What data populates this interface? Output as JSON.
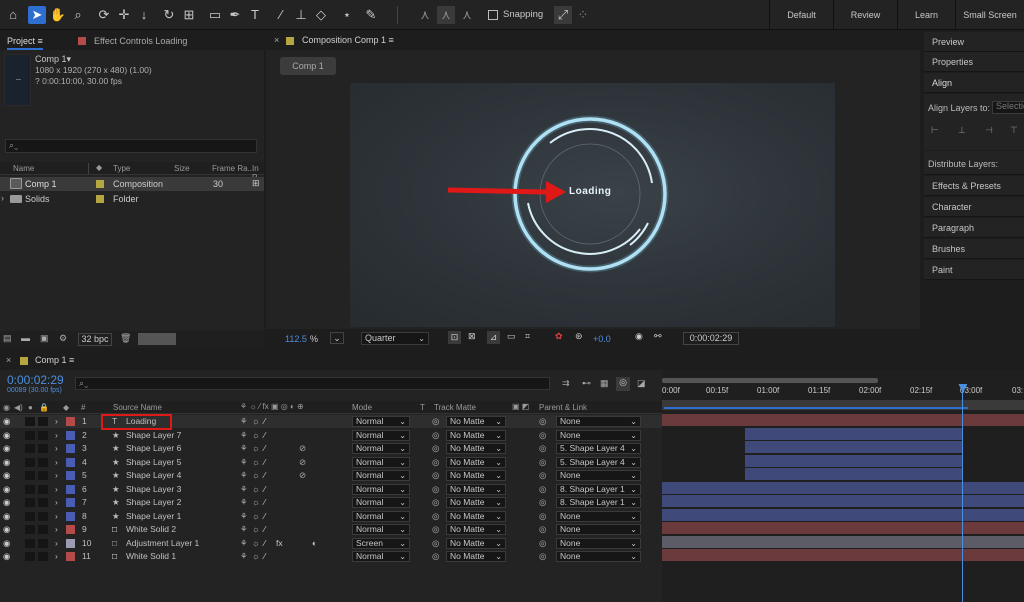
{
  "toolbar": {
    "icons": [
      "home-icon",
      "selection-tool-icon",
      "hand-tool-icon",
      "zoom-tool-icon",
      "orbit-camera-icon",
      "pan-camera-icon",
      "dolly-camera-icon",
      "rotation-tool-icon",
      "pan-behind-icon",
      "rectangle-tool-icon",
      "pen-tool-icon",
      "type-tool-icon",
      "brush-tool-icon",
      "clone-stamp-icon",
      "eraser-tool-icon",
      "roto-brush-icon",
      "puppet-pin-icon"
    ],
    "snapping_label": "Snapping",
    "workspaces": [
      "Default",
      "Review",
      "Learn",
      "Small Screen"
    ]
  },
  "project": {
    "tab_label": "Project",
    "effect_tab_label": "Effect Controls Loading",
    "comp_name": "Comp 1▾",
    "comp_dims": "1080 x 1920  (270 x 480) (1.00)",
    "comp_duration": "? 0:00:10:00, 30.00 fps",
    "search_placeholder": "",
    "columns": [
      "Name",
      "Type",
      "Size",
      "Frame Ra...",
      "In P"
    ],
    "items": [
      {
        "name": "Comp 1",
        "type": "Composition",
        "size": "",
        "fps": "30",
        "color": "#b5a642"
      },
      {
        "name": "Solids",
        "type": "Folder",
        "size": "",
        "fps": "",
        "color": "#b5a642"
      }
    ],
    "bpc_label": "32 bpc"
  },
  "composition": {
    "tab_label": "Composition Comp 1",
    "comp_button": "Comp 1",
    "loading_text": "Loading",
    "zoom": "112.5",
    "zoom_unit": "%",
    "resolution": "Quarter",
    "exposure": "+0.0",
    "timecode": "0:00:02:29"
  },
  "right_panel": {
    "items": [
      "Preview",
      "Properties",
      "Align"
    ],
    "align_layers_to": "Align Layers to:",
    "align_select": "Selection",
    "distribute": "Distribute Layers:",
    "more": [
      "Effects & Presets",
      "Character",
      "Paragraph",
      "Brushes",
      "Paint"
    ]
  },
  "timeline": {
    "tab_label": "Comp 1",
    "timecode": "0:00:02:29",
    "frame_info": "00089 (30.00 fps)",
    "col_source": "Source Name",
    "col_mode": "Mode",
    "col_t": "T",
    "col_track": "Track Matte",
    "col_parent": "Parent & Link",
    "ruler": [
      "0:00f",
      "00:15f",
      "01:00f",
      "01:15f",
      "02:00f",
      "02:15f",
      "03:00f",
      "03:"
    ],
    "playhead_fraction": 0.83,
    "layers": [
      {
        "n": "1",
        "name": "Loading",
        "kind": "text",
        "color": "#b44a4a",
        "mode": "Normal",
        "matte": "No Matte",
        "parent": "None",
        "bar_color": "#6a3a3c",
        "bar_start": 0.0,
        "bar_end": 1.0
      },
      {
        "n": "2",
        "name": "Shape Layer 7",
        "kind": "shape",
        "color": "#4a5db4",
        "mode": "Normal",
        "matte": "No Matte",
        "parent": "None",
        "bar_color": "#3f4a7a",
        "bar_start": 0.23,
        "bar_end": 0.83
      },
      {
        "n": "3",
        "name": "Shape Layer 6",
        "kind": "shape",
        "color": "#4a5db4",
        "mode": "Normal",
        "matte": "No Matte",
        "parent": "5. Shape Layer 4",
        "bar_color": "#3f4a7a",
        "bar_start": 0.23,
        "bar_end": 0.83
      },
      {
        "n": "4",
        "name": "Shape Layer 5",
        "kind": "shape",
        "color": "#4a5db4",
        "mode": "Normal",
        "matte": "No Matte",
        "parent": "5. Shape Layer 4",
        "bar_color": "#3f4a7a",
        "bar_start": 0.23,
        "bar_end": 0.83
      },
      {
        "n": "5",
        "name": "Shape Layer 4",
        "kind": "shape",
        "color": "#4a5db4",
        "mode": "Normal",
        "matte": "No Matte",
        "parent": "None",
        "bar_color": "#3f4a7a",
        "bar_start": 0.23,
        "bar_end": 0.83
      },
      {
        "n": "6",
        "name": "Shape Layer 3",
        "kind": "shape",
        "color": "#4a5db4",
        "mode": "Normal",
        "matte": "No Matte",
        "parent": "8. Shape Layer 1",
        "bar_color": "#3f4a7a",
        "bar_start": 0.0,
        "bar_end": 1.0
      },
      {
        "n": "7",
        "name": "Shape Layer 2",
        "kind": "shape",
        "color": "#4a5db4",
        "mode": "Normal",
        "matte": "No Matte",
        "parent": "8. Shape Layer 1",
        "bar_color": "#3f4a7a",
        "bar_start": 0.0,
        "bar_end": 1.0
      },
      {
        "n": "8",
        "name": "Shape Layer 1",
        "kind": "shape",
        "color": "#4a5db4",
        "mode": "Normal",
        "matte": "No Matte",
        "parent": "None",
        "bar_color": "#3f4a7a",
        "bar_start": 0.0,
        "bar_end": 1.0
      },
      {
        "n": "9",
        "name": "White Solid 2",
        "kind": "solid",
        "color": "#b44a4a",
        "mode": "Normal",
        "matte": "No Matte",
        "parent": "None",
        "bar_color": "#6a3a3c",
        "bar_start": 0.0,
        "bar_end": 1.0
      },
      {
        "n": "10",
        "name": "Adjustment Layer 1",
        "kind": "adjust",
        "color": "#9a9ab0",
        "mode": "Screen",
        "matte": "No Matte",
        "parent": "None",
        "bar_color": "#5c5c66",
        "bar_start": 0.0,
        "bar_end": 1.0
      },
      {
        "n": "11",
        "name": "White Solid 1",
        "kind": "solid",
        "color": "#b44a4a",
        "mode": "Normal",
        "matte": "No Matte",
        "parent": "None",
        "bar_color": "#6a3a3c",
        "bar_start": 0.0,
        "bar_end": 1.0
      }
    ]
  }
}
